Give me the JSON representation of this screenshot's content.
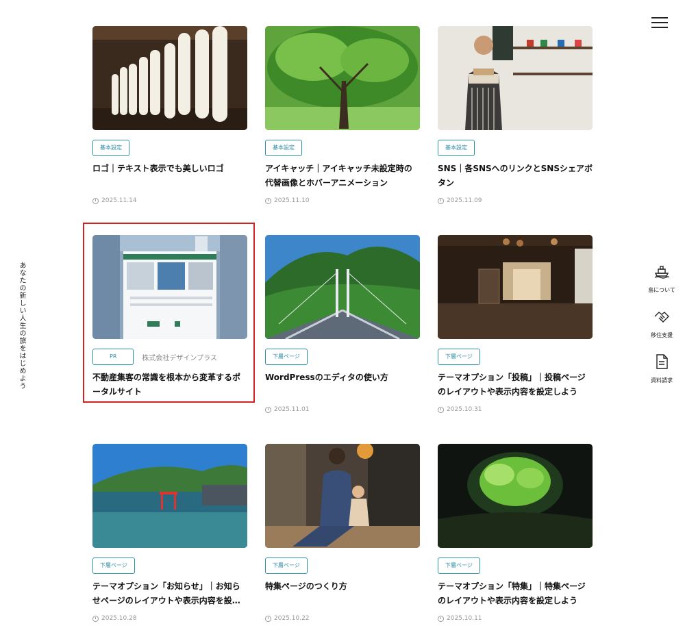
{
  "header": {
    "menu_icon": "hamburger-icon"
  },
  "tagline": "あなたの新しい人生の旅をはじめよう",
  "sidenav": [
    {
      "label": "島について",
      "icon": "ship-icon"
    },
    {
      "label": "移住支援",
      "icon": "handshake-icon"
    },
    {
      "label": "資料請求",
      "icon": "document-icon"
    }
  ],
  "colors": {
    "accent": "#2e8fa8",
    "highlight": "#d42020"
  },
  "cards": [
    {
      "badge": "基本設定",
      "title": "ロゴ｜テキスト表示でも美しいロゴ",
      "date": "2025.11.14",
      "image": "hanging-daikon-radish"
    },
    {
      "badge": "基本設定",
      "title": "アイキャッチ｜アイキャッチ未設定時の代替画像とホバーアニメーション",
      "date": "2025.11.10",
      "image": "green-tree-forest"
    },
    {
      "badge": "基本設定",
      "title": "SNS｜各SNSへのリンクとSNSシェアボタン",
      "date": "2025.11.09",
      "image": "barista-with-cups"
    },
    {
      "badge": "PR",
      "sponsor": "株式会社デザインプラス",
      "title": "不動産集客の常識を根本から変革するポータルサイト",
      "date": "",
      "image": "real-estate-website"
    },
    {
      "badge": "下層ページ",
      "title": "WordPressのエディタの使い方",
      "date": "2025.11.01",
      "image": "suspension-bridge-mountains"
    },
    {
      "badge": "下層ページ",
      "title": "テーマオプション「投稿」｜投稿ページのレイアウトや表示内容を設定しよう",
      "date": "2025.10.31",
      "image": "traditional-house-interior"
    },
    {
      "badge": "下層ページ",
      "title": "テーマオプション「お知らせ」｜お知らせページのレイアウトや表示内容を設…",
      "date": "2025.10.28",
      "image": "torii-gate-sea"
    },
    {
      "badge": "下層ページ",
      "title": "特集ページのつくり方",
      "date": "2025.10.22",
      "image": "father-and-child-porch"
    },
    {
      "badge": "下層ページ",
      "title": "テーマオプション「特集」｜特集ページのレイアウトや表示内容を設定しよう",
      "date": "2025.10.11",
      "image": "cave-opening-greenery"
    }
  ]
}
